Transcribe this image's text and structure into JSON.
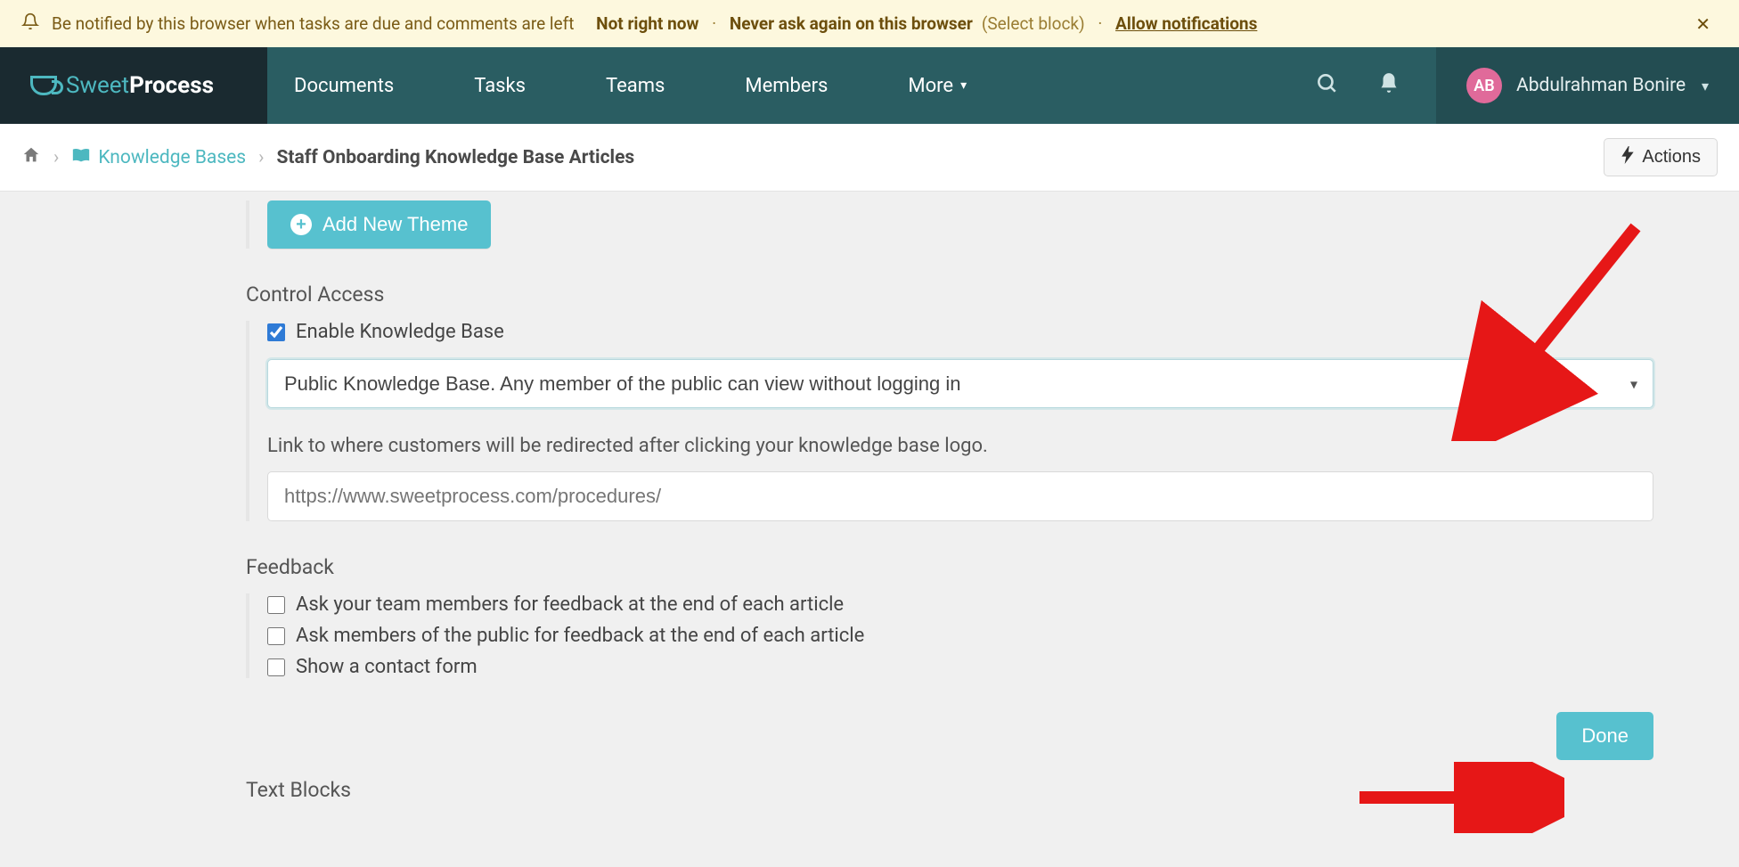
{
  "notif": {
    "prefix": "Be notified by this browser when tasks are due and comments are left",
    "not_now": "Not right now",
    "never": "Never ask again on this browser",
    "select_block": "(Select block)",
    "allow": "Allow notifications"
  },
  "brand": {
    "sweet": "Sweet",
    "process": "Process"
  },
  "nav": {
    "documents": "Documents",
    "tasks": "Tasks",
    "teams": "Teams",
    "members": "Members",
    "more": "More"
  },
  "user": {
    "initials": "AB",
    "name": "Abdulrahman Bonire"
  },
  "crumbs": {
    "kb_label": "Knowledge Bases",
    "current": "Staff Onboarding Knowledge Base Articles"
  },
  "actions_label": "Actions",
  "theme": {
    "add_label": "Add New Theme"
  },
  "access": {
    "title": "Control Access",
    "enable_label": "Enable Knowledge Base",
    "enable_checked": true,
    "select_value": "Public Knowledge Base. Any member of the public can view without logging in",
    "redirect_help": "Link to where customers will be redirected after clicking your knowledge base logo.",
    "redirect_placeholder": "https://www.sweetprocess.com/procedures/"
  },
  "feedback": {
    "title": "Feedback",
    "opt1": "Ask your team members for feedback at the end of each article",
    "opt2": "Ask members of the public for feedback at the end of each article",
    "opt3": "Show a contact form"
  },
  "done_label": "Done",
  "textblocks_title": "Text Blocks"
}
